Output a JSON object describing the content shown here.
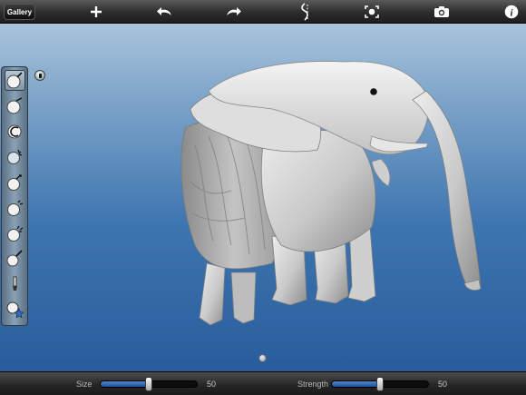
{
  "toolbar": {
    "gallery_label": "Gallery",
    "icons": [
      "add-icon",
      "undo-icon",
      "redo-icon",
      "symmetry-icon",
      "camera-reset-icon",
      "camera-icon",
      "info-icon"
    ]
  },
  "tools": [
    {
      "name": "draw-tool-icon",
      "selected": true
    },
    {
      "name": "flatten-tool-icon",
      "selected": false
    },
    {
      "name": "pinch-tool-icon",
      "selected": false
    },
    {
      "name": "smooth-tool-icon",
      "selected": false
    },
    {
      "name": "grab-tool-icon",
      "selected": false
    },
    {
      "name": "inflate-tool-icon",
      "selected": false
    },
    {
      "name": "crease-tool-icon",
      "selected": false
    },
    {
      "name": "paint-tool-icon",
      "selected": false
    },
    {
      "name": "brush-tool-icon",
      "selected": false
    },
    {
      "name": "favorite-tool-icon",
      "selected": false
    }
  ],
  "bottom": {
    "size_label": "Size",
    "size_value": "50",
    "size_fraction": 0.5,
    "strength_label": "Strength",
    "strength_value": "50",
    "strength_fraction": 0.5
  },
  "colors": {
    "accent": "#2a64b0",
    "viewport_top": "#a9c4dc",
    "viewport_bottom": "#285d9b"
  }
}
